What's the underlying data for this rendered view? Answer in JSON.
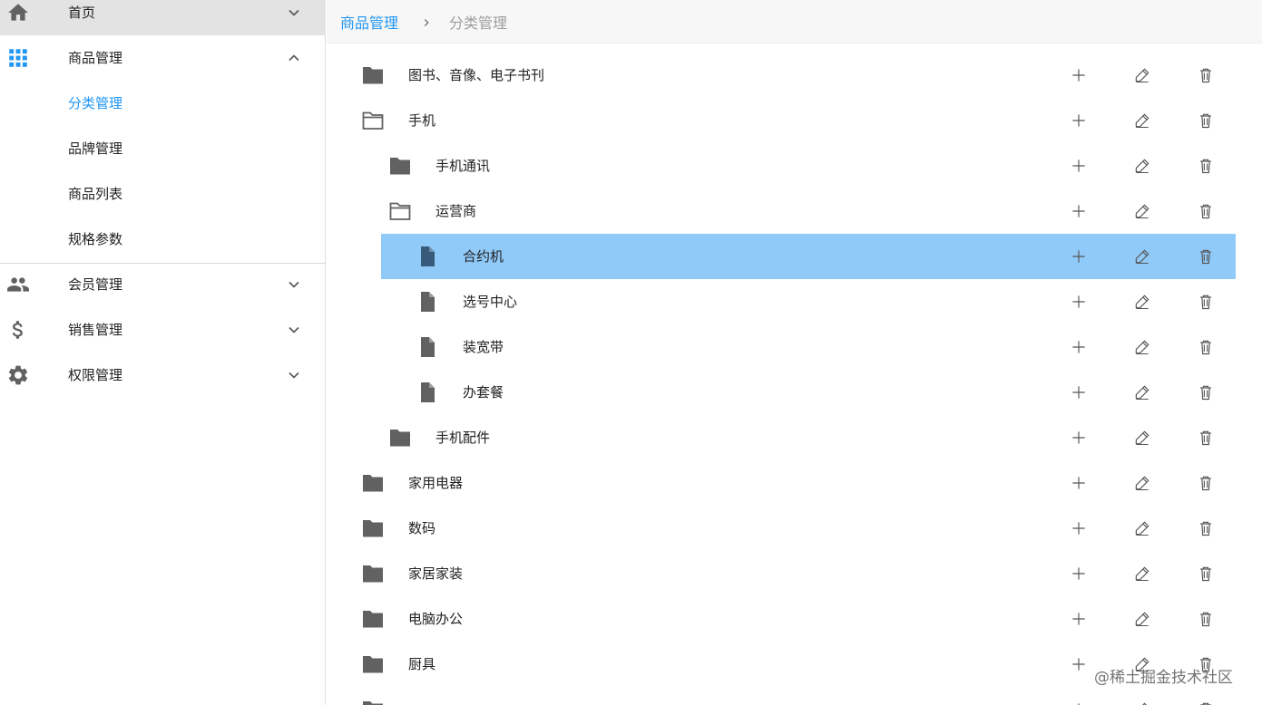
{
  "sidebar": {
    "home": {
      "label": "首页",
      "icon": "home-icon"
    },
    "product": {
      "label": "商品管理",
      "icon": "apps-grid-icon",
      "accent": "#2196f3",
      "children": [
        {
          "label": "分类管理",
          "active": true
        },
        {
          "label": "品牌管理"
        },
        {
          "label": "商品列表"
        },
        {
          "label": "规格参数"
        }
      ]
    },
    "members": {
      "label": "会员管理",
      "icon": "people-icon"
    },
    "sales": {
      "label": "销售管理",
      "icon": "dollar-icon"
    },
    "permissions": {
      "label": "权限管理",
      "icon": "gear-icon"
    }
  },
  "breadcrumb": {
    "parent": "商品管理",
    "current": "分类管理"
  },
  "tree": {
    "rows": [
      {
        "label": "图书、音像、电子书刊",
        "level": 0,
        "icon": "folder-filled-icon"
      },
      {
        "label": "手机",
        "level": 0,
        "icon": "folder-open-icon"
      },
      {
        "label": "手机通讯",
        "level": 1,
        "icon": "folder-filled-icon"
      },
      {
        "label": "运营商",
        "level": 1,
        "icon": "folder-open-icon"
      },
      {
        "label": "合约机",
        "level": 2,
        "icon": "file-icon",
        "selected": true
      },
      {
        "label": "选号中心",
        "level": 2,
        "icon": "file-icon"
      },
      {
        "label": "装宽带",
        "level": 2,
        "icon": "file-icon"
      },
      {
        "label": "办套餐",
        "level": 2,
        "icon": "file-icon"
      },
      {
        "label": "手机配件",
        "level": 1,
        "icon": "folder-filled-icon"
      },
      {
        "label": "家用电器",
        "level": 0,
        "icon": "folder-filled-icon"
      },
      {
        "label": "数码",
        "level": 0,
        "icon": "folder-filled-icon"
      },
      {
        "label": "家居家装",
        "level": 0,
        "icon": "folder-filled-icon"
      },
      {
        "label": "电脑办公",
        "level": 0,
        "icon": "folder-filled-icon"
      },
      {
        "label": "厨具",
        "level": 0,
        "icon": "folder-filled-icon"
      },
      {
        "label": "",
        "level": 0,
        "icon": "folder-filled-icon"
      }
    ],
    "actions": [
      "add-icon",
      "edit-icon",
      "delete-icon"
    ],
    "selected_color": "#90caf9"
  },
  "watermark": "@稀土掘金技术社区"
}
